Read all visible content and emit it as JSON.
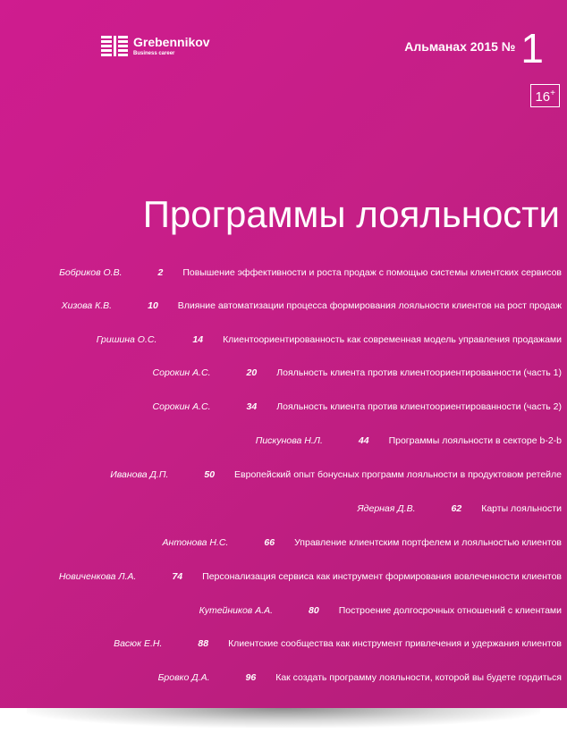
{
  "brand": {
    "name": "Grebennikov",
    "tagline": "Business career"
  },
  "almanac": {
    "label": "Альманах 2015 №",
    "number": "1"
  },
  "age_rating": "16",
  "age_rating_plus": "+",
  "title": "Программы лояльности",
  "toc": [
    {
      "author": "Бобриков О.В.",
      "page": "2",
      "title": "Повышение эффективности и роста продаж с помощью системы клиентских сервисов"
    },
    {
      "author": "Хизова К.В.",
      "page": "10",
      "title": "Влияние автоматизации процесса формирования лояльности клиентов на рост продаж"
    },
    {
      "author": "Гришина О.С.",
      "page": "14",
      "title": "Клиентоориентированность как современная модель управления продажами"
    },
    {
      "author": "Сорокин А.С.",
      "page": "20",
      "title": "Лояльность клиента против клиентоориентированности (часть 1)"
    },
    {
      "author": "Сорокин А.С.",
      "page": "34",
      "title": "Лояльность клиента против клиентоориентированности (часть 2)"
    },
    {
      "author": "Пискунова Н.Л.",
      "page": "44",
      "title": "Программы лояльности в секторе b-2-b"
    },
    {
      "author": "Иванова Д.П.",
      "page": "50",
      "title": "Европейский опыт бонусных программ лояльности в продуктовом ретейле"
    },
    {
      "author": "Ядерная Д.В.",
      "page": "62",
      "title": "Карты лояльности"
    },
    {
      "author": "Антонова Н.С.",
      "page": "66",
      "title": "Управление клиентским портфелем и лояльностью клиентов"
    },
    {
      "author": "Новиченкова Л.А.",
      "page": "74",
      "title": "Персонализация сервиса как инструмент формирования вовлеченности клиентов"
    },
    {
      "author": "Кутейников А.А.",
      "page": "80",
      "title": "Построение долгосрочных отношений с клиентами"
    },
    {
      "author": "Васюк Е.Н.",
      "page": "88",
      "title": "Клиентские сообщества как инструмент привлечения и удержания клиентов"
    },
    {
      "author": "Бровко Д.А.",
      "page": "96",
      "title": "Как создать программу лояльности, которой вы будете гордиться"
    }
  ]
}
